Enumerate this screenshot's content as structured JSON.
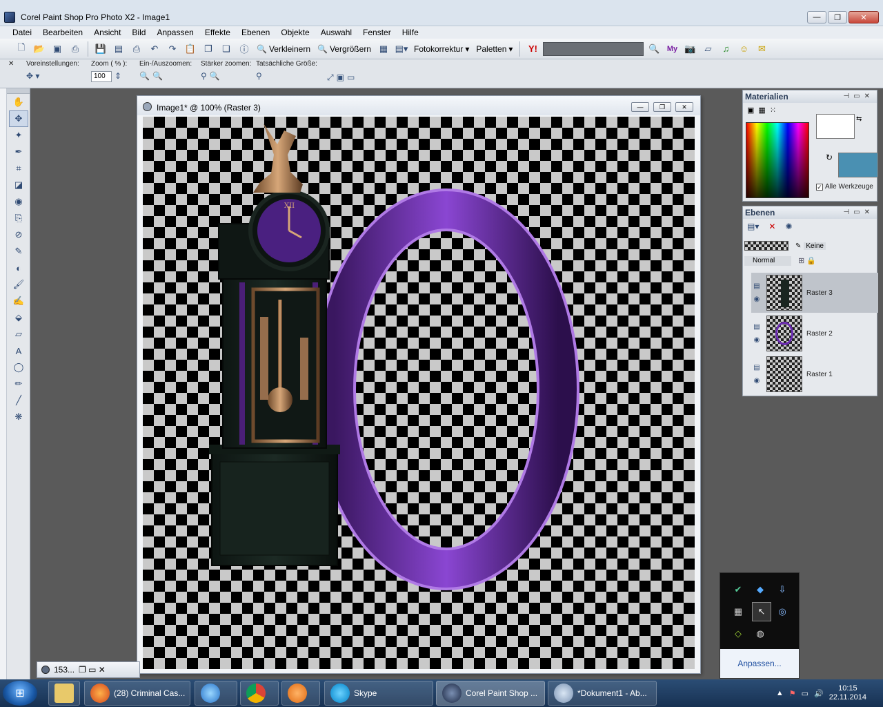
{
  "window": {
    "title": "Corel Paint Shop Pro Photo X2 - Image1",
    "minimize": "—",
    "maximize": "❐",
    "close": "✕"
  },
  "menu": [
    "Datei",
    "Bearbeiten",
    "Ansicht",
    "Bild",
    "Anpassen",
    "Effekte",
    "Ebenen",
    "Objekte",
    "Auswahl",
    "Fenster",
    "Hilfe"
  ],
  "toolbar": {
    "zoom_out": "Verkleinern",
    "zoom_in": "Vergrößern",
    "photo_fix": "Fotokorrektur",
    "palettes": "Paletten"
  },
  "options": {
    "presets": "Voreinstellungen:",
    "zoom_label": "Zoom ( % ):",
    "zoom_value": "100",
    "zoom_inout": "Ein-/Auszoomen:",
    "zoom_more": "Stärker zoomen:",
    "actual_size": "Tatsächliche Größe:"
  },
  "document": {
    "title": "Image1* @ 100% (Raster 3)",
    "minimized_title": "153..."
  },
  "materials": {
    "title": "Materialien",
    "all_tools": "Alle Werkzeuge",
    "fg_color": "#ffffff",
    "bg_color": "#4a90b2"
  },
  "layers": {
    "title": "Ebenen",
    "blend_mode": "Normal",
    "mask": "Keine",
    "items": [
      {
        "name": "Raster 3"
      },
      {
        "name": "Raster 2"
      },
      {
        "name": "Raster 1"
      }
    ]
  },
  "tray_popup": {
    "customize": "Anpassen..."
  },
  "taskbar": {
    "items": [
      {
        "label": "(28) Criminal Cas..."
      },
      {
        "label": ""
      },
      {
        "label": ""
      },
      {
        "label": ""
      },
      {
        "label": "Skype"
      },
      {
        "label": "Corel Paint Shop ..."
      },
      {
        "label": "*Dokument1 - Ab..."
      }
    ],
    "time": "10:15",
    "date": "22.11.2014"
  }
}
